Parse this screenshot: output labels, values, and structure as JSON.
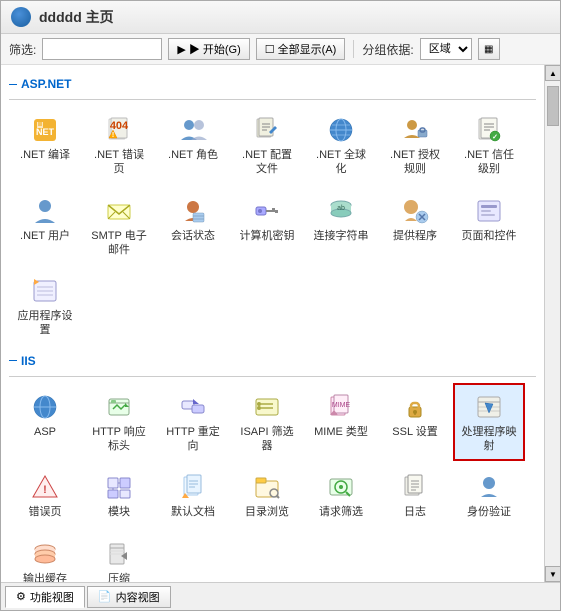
{
  "window": {
    "title": "ddddd 主页"
  },
  "toolbar": {
    "filter_label": "筛选:",
    "filter_placeholder": "",
    "start_btn": "▶ 开始(G)",
    "show_all_btn": "☐ 全部显示(A)",
    "group_label": "分组依据:",
    "group_value": "区域",
    "grid_icon": "▦"
  },
  "sections": [
    {
      "id": "aspnet",
      "label": "ASP.NET",
      "items": [
        {
          "id": "aspnet-compile",
          "label": ".NET 编译",
          "icon": "aspnet-compile"
        },
        {
          "id": "aspnet-error",
          "label": ".NET 错误页",
          "icon": "aspnet-error"
        },
        {
          "id": "aspnet-role",
          "label": ".NET 角色",
          "icon": "aspnet-role"
        },
        {
          "id": "aspnet-config",
          "label": ".NET 配置文件",
          "icon": "aspnet-config"
        },
        {
          "id": "aspnet-global",
          "label": ".NET 全球化",
          "icon": "aspnet-global"
        },
        {
          "id": "aspnet-authz",
          "label": ".NET 授权规则",
          "icon": "aspnet-authz"
        },
        {
          "id": "aspnet-trust",
          "label": ".NET 信任级别",
          "icon": "aspnet-trust"
        },
        {
          "id": "aspnet-user",
          "label": ".NET 用户",
          "icon": "aspnet-user"
        },
        {
          "id": "aspnet-smtp",
          "label": "SMTP 电子邮件",
          "icon": "aspnet-smtp"
        },
        {
          "id": "aspnet-session",
          "label": "会话状态",
          "icon": "aspnet-session"
        },
        {
          "id": "aspnet-machinekey",
          "label": "计算机密钥",
          "icon": "aspnet-machinekey"
        },
        {
          "id": "aspnet-connstr",
          "label": "连接字符串",
          "icon": "aspnet-connstr"
        },
        {
          "id": "aspnet-provider",
          "label": "提供程序",
          "icon": "aspnet-provider"
        },
        {
          "id": "aspnet-pagecontrol",
          "label": "页面和控件",
          "icon": "aspnet-pagecontrol"
        },
        {
          "id": "aspnet-appset",
          "label": "应用程序设置",
          "icon": "aspnet-appset"
        }
      ]
    },
    {
      "id": "iis",
      "label": "IIS",
      "items": [
        {
          "id": "iis-asp",
          "label": "ASP",
          "icon": "iis-asp"
        },
        {
          "id": "iis-httpresp",
          "label": "HTTP 响应标头",
          "icon": "iis-httpresp"
        },
        {
          "id": "iis-httpredir",
          "label": "HTTP 重定向",
          "icon": "iis-httpredir"
        },
        {
          "id": "iis-isapi",
          "label": "ISAPI 筛选器",
          "icon": "iis-isapi"
        },
        {
          "id": "iis-mime",
          "label": "MIME 类型",
          "icon": "iis-mime"
        },
        {
          "id": "iis-ssl",
          "label": "SSL 设置",
          "icon": "iis-ssl"
        },
        {
          "id": "iis-handler",
          "label": "处理程序映射",
          "icon": "iis-handler",
          "selected": true
        },
        {
          "id": "iis-errorpage",
          "label": "错误页",
          "icon": "iis-errorpage"
        },
        {
          "id": "iis-module",
          "label": "模块",
          "icon": "iis-module"
        },
        {
          "id": "iis-default",
          "label": "默认文档",
          "icon": "iis-default"
        },
        {
          "id": "iis-dirbrowse",
          "label": "目录浏览",
          "icon": "iis-dirbrowse"
        },
        {
          "id": "iis-reqfilter",
          "label": "请求筛选",
          "icon": "iis-reqfilter"
        },
        {
          "id": "iis-log",
          "label": "日志",
          "icon": "iis-log"
        },
        {
          "id": "iis-authverify",
          "label": "身份验证",
          "icon": "iis-authverify"
        },
        {
          "id": "iis-outputcache",
          "label": "输出缓存",
          "icon": "iis-outputcache"
        },
        {
          "id": "iis-compress",
          "label": "压缩",
          "icon": "iis-compress"
        }
      ]
    }
  ],
  "bottom": {
    "func_view": "功能视图",
    "content_view": "内容视图"
  }
}
